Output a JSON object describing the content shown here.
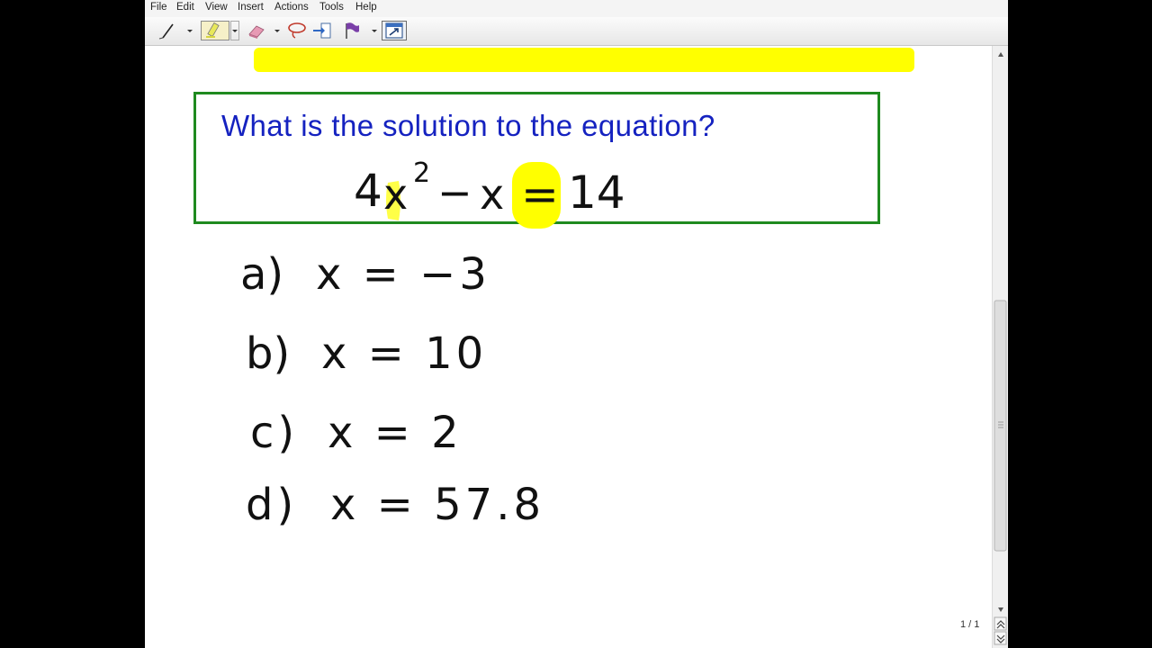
{
  "menu": [
    "File",
    "Edit",
    "View",
    "Insert",
    "Actions",
    "Tools",
    "Help"
  ],
  "toolbar": {
    "icons": [
      "pen-icon",
      "highlighter-icon",
      "eraser-icon",
      "lasso-icon",
      "insert-space-icon",
      "flag-icon",
      "full-page-icon"
    ]
  },
  "question": {
    "text": "What is the solution to the equation?",
    "equation": {
      "coef": "4",
      "var": "x",
      "exponent": "2",
      "minus": "−",
      "var2": "x",
      "equals": "=",
      "rhs": "14"
    }
  },
  "options": [
    {
      "letter": "a)",
      "value": "x = −3"
    },
    {
      "letter": "b)",
      "value": "x = 10"
    },
    {
      "letter": "c)",
      "value": "x = 2"
    },
    {
      "letter": "d)",
      "value": "x = 57.8"
    }
  ],
  "page_indicator": "1 / 1",
  "colors": {
    "question_text": "#1522c0",
    "box_border": "#1f8a1f",
    "highlight": "#ffff00",
    "ink": "#111111"
  }
}
